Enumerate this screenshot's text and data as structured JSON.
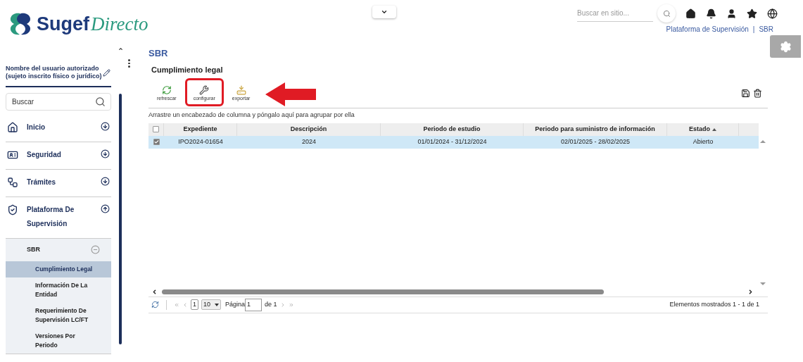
{
  "header": {
    "logo": {
      "part_1": "Sugef",
      "part_2": "Directo"
    },
    "search": {
      "placeholder": "Buscar en sitio..."
    },
    "breadcrumb": [
      "Plataforma de Supervisión",
      "SBR"
    ],
    "separator": "|"
  },
  "sidebar": {
    "user": "Nombre del usuario autorizado (sujeto inscrito físico o jurídico)",
    "search": {
      "placeholder": "Buscar"
    },
    "items": [
      {
        "label": "Inicio",
        "kind": "home",
        "expanded": false
      },
      {
        "label": "Seguridad",
        "kind": "badge",
        "expanded": false
      },
      {
        "label": "Trámites",
        "kind": "flow",
        "expanded": false
      },
      {
        "label": "Plataforma De Supervisión",
        "kind": "shield",
        "expanded": true,
        "children": [
          {
            "label": "SBR",
            "expanded": true,
            "children": [
              {
                "label": "Cumplimiento Legal",
                "selected": true
              },
              {
                "label": "Información De La Entidad",
                "selected": false
              },
              {
                "label": "Requerimiento De Supervisión LC/FT",
                "selected": false
              },
              {
                "label": "Versiones Por Periodo",
                "selected": false
              }
            ]
          }
        ]
      }
    ]
  },
  "main": {
    "section": "SBR",
    "title": "Cumplimiento legal",
    "toolbar": [
      {
        "label": "refrescar",
        "kind": "refresh",
        "highlighted": false
      },
      {
        "label": "configurar",
        "kind": "tools",
        "highlighted": true
      },
      {
        "label": "exportar",
        "kind": "export",
        "highlighted": false
      }
    ],
    "group_hint": "Arrastre un encabezado de columna y póngalo aquí para agrupar por ella",
    "table": {
      "all_checked": false,
      "columns": [
        {
          "label": "Expediente",
          "sorted": false
        },
        {
          "label": "Descripción",
          "sorted": false
        },
        {
          "label": "Periodo de estudio",
          "sorted": false
        },
        {
          "label": "Periodo para suministro de información",
          "sorted": false
        },
        {
          "label": "Estado",
          "sorted": true
        }
      ],
      "rows": [
        {
          "checked": true,
          "selected": true,
          "cells": [
            "IPO2024-01654",
            "2024",
            "01/01/2024 - 31/12/2024",
            "02/01/2025 - 28/02/2025",
            "Abierto"
          ]
        }
      ]
    },
    "pager": {
      "current": "1",
      "page_size": "10",
      "page_label": "Página",
      "page_value": "1",
      "page_total": "de 1",
      "summary": "Elementos mostrados 1 - 1 de 1"
    }
  }
}
